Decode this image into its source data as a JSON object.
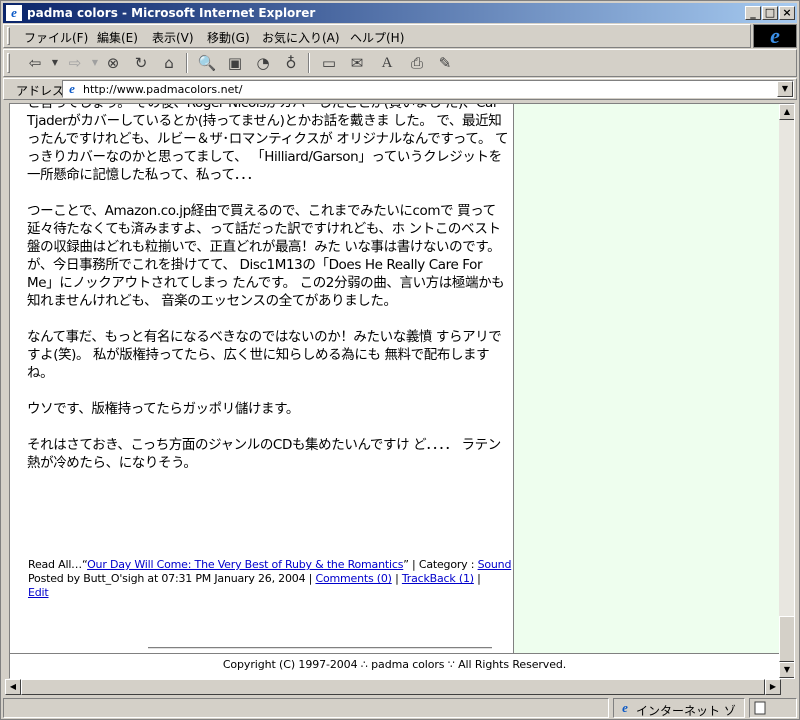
{
  "window": {
    "title": "padma colors - Microsoft Internet Explorer",
    "icon": "ie-page-icon",
    "controls": {
      "minimize": "_",
      "maximize": "□",
      "close": "×"
    }
  },
  "menu": {
    "items": [
      "ファイル(F)",
      "編集(E)",
      "表示(V)",
      "移動(G)",
      "お気に入り(A)",
      "ヘルプ(H)"
    ]
  },
  "toolbar": {
    "buttons": [
      {
        "icon": "back-icon",
        "glyph": "⇦"
      },
      {
        "icon": "forward-icon",
        "glyph": "⇨"
      },
      {
        "icon": "stop-icon",
        "glyph": "⊗"
      },
      {
        "icon": "refresh-icon",
        "glyph": "↻"
      },
      {
        "icon": "home-icon",
        "glyph": "⌂"
      },
      {
        "icon": "search-icon",
        "glyph": "🔍"
      },
      {
        "icon": "favorites-icon",
        "glyph": "▣"
      },
      {
        "icon": "history-icon",
        "glyph": "◔"
      },
      {
        "icon": "channels-icon",
        "glyph": "♁"
      },
      {
        "icon": "fullscreen-icon",
        "glyph": "▭"
      },
      {
        "icon": "mail-icon",
        "glyph": "✉"
      },
      {
        "icon": "font-size-icon",
        "glyph": "A"
      },
      {
        "icon": "print-icon",
        "glyph": "⎙"
      },
      {
        "icon": "edit-icon",
        "glyph": "✎"
      }
    ]
  },
  "address": {
    "label": "アドレス",
    "value": "http://www.padmacolors.net/"
  },
  "article": {
    "paragraphs": [
      "と言ってしょう。 その後、Roger Nicolsがカバーしたことが(買いまし た)、Cal Tjaderがカバーしているとか(持ってません)とかお話を戴きま した。 で、最近知ったんですけれども、ルビー＆ザ･ロマンティクスが オリジナルなんですって。 てっきりカバーなのかと思ってまして、 「Hilliard/Garson」っていうクレジットを一所懸命に記憶した私って、私って．．．",
      "つーことで、Amazon.co.jp経由で買えるので、これまでみたいにcomで 買って延々待たなくても済みますよ、って話だった訳ですけれども、ホ ントこのベスト盤の収録曲はどれも粒揃いで、正直どれが最高！みた いな事は書けないのです。 が、今日事務所でこれを掛けてて、 Disc1M13の「Does He Really Care For Me」にノックアウトされてしまっ たんです。 この2分弱の曲、言い方は極端かも知れませんけれども、 音楽のエッセンスの全てがありました。",
      "なんて事だ、もっと有名になるべきなのではないのか！みたいな義憤 すらアリですよ(笑)。 私が版権持ってたら、広く世に知らしめる為にも 無料で配布しますね。",
      "ウソです、版権持ってたらガッポリ儲けます。",
      "それはさておき、こっち方面のジャンルのCDも集めたいんですけ ど．．．． ラテン熱が冷めたら、になりそう。"
    ],
    "meta": {
      "read_all_prefix": "Read All…“",
      "read_all_link": "Our Day Will Come: The Very Best of Ruby & the Romantics",
      "read_all_suffix": "” | Category : ",
      "category": "Sound",
      "posted_by": "Posted by Butt_O'sigh at 07:31 PM January 26, 2004 | ",
      "comments": "Comments (0)",
      "sep": " | ",
      "trackback": "TrackBack (1)",
      "sep2": " |",
      "edit": "Edit"
    }
  },
  "footer": {
    "copyright": "Copyright (C)  1997-2004   ∴ padma colors  ∵   All Rights Reserved."
  },
  "status": {
    "zone": "インターネット ゾーン",
    "text": ""
  }
}
